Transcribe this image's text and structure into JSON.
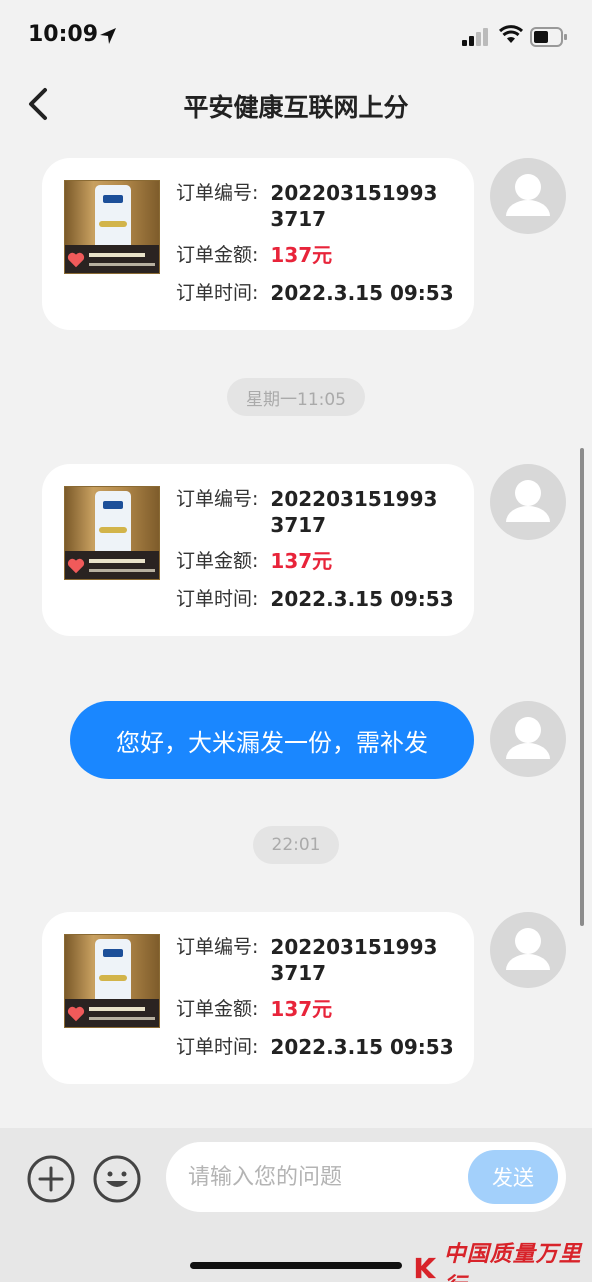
{
  "status_bar": {
    "time": "10:09"
  },
  "header": {
    "title": "平安健康互联网上分"
  },
  "orders": [
    {
      "label_no": "订单编号:",
      "order_no": "2022031519933717",
      "label_amount": "订单金额:",
      "amount": "137元",
      "label_time": "订单时间:",
      "time": "2022.3.15 09:53"
    },
    {
      "label_no": "订单编号:",
      "order_no": "2022031519933717",
      "label_amount": "订单金额:",
      "amount": "137元",
      "label_time": "订单时间:",
      "time": "2022.3.15 09:53"
    },
    {
      "label_no": "订单编号:",
      "order_no": "2022031519933717",
      "label_amount": "订单金额:",
      "amount": "137元",
      "label_time": "订单时间:",
      "time": "2022.3.15 09:53"
    }
  ],
  "timestamps": [
    "星期一11:05",
    "22:01"
  ],
  "message": {
    "text": "您好，大米漏发一份，需补发"
  },
  "input": {
    "placeholder": "请输入您的问题",
    "send_label": "发送"
  },
  "watermark": {
    "text": "中国质量万里行"
  },
  "colors": {
    "accent": "#1a87ff",
    "price": "#e8243a",
    "send_disabled": "#a3d0fb"
  }
}
